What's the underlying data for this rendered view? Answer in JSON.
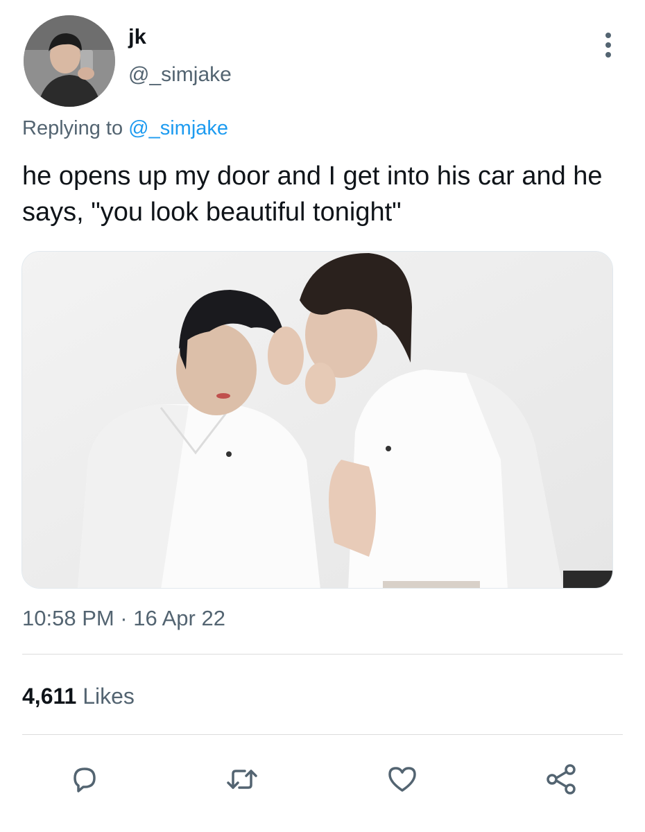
{
  "tweet": {
    "display_name": "jk",
    "handle": "@_simjake",
    "replying_prefix": "Replying to",
    "replying_mention": "@_simjake",
    "text": "he opens up my door and I get into his car and he says, \"you look beautiful tonight\"",
    "timestamp": "10:58 PM · 16 Apr 22"
  },
  "stats": {
    "likes_count": "4,611",
    "likes_label": "Likes"
  },
  "icons": {
    "more": "more-vertical-icon",
    "reply": "reply-icon",
    "retweet": "retweet-icon",
    "like": "heart-icon",
    "share": "share-icon"
  },
  "colors": {
    "text_primary": "#0f1419",
    "text_secondary": "#536471",
    "accent": "#1d9bf0",
    "divider": "#dcdcdc"
  }
}
